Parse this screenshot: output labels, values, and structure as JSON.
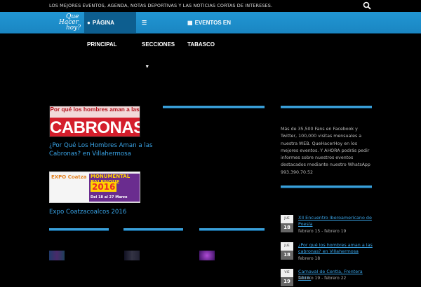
{
  "topbar": {
    "tagline": "LOS MEJORES EVENTOS, AGENDA, NOTAS DEPORTIVAS Y LAS NOTICIAS CORTAS DE INTERESES."
  },
  "logo": {
    "line1": "Que",
    "line2": "Hacer",
    "line3": "hoy?"
  },
  "nav": {
    "home": "PÁGINA PRINCIPAL",
    "sections": "SECCIONES",
    "events": "EVENTOS EN TABASCO"
  },
  "posts": [
    {
      "banner_line1": "Por qué los hombres aman a las",
      "banner_line2": "CABRONAS",
      "title": "¿Por Qué Los Hombres Aman a las Cabronas? en Villahermosa"
    },
    {
      "banner_left": "EXPO Coatza",
      "banner_title": "MONUMENTAL PALENQUE",
      "banner_year": "2016",
      "banner_date": "Del 18 al 27 Marzo",
      "title": "Expo Coatzacoalcos 2016"
    }
  ],
  "sidebar": {
    "about": "Más de 35,500 Fans en Facebook y Twitter, 100,000 visitas mensuales a nuestra WEB. QueHacerHoy en los mejores eventos. Y AHORA podrás pedir informes sobre nuestros eventos destacados mediante nuestro WhatsApp 993.390.70.52",
    "events": [
      {
        "month": "JUE",
        "day": "18",
        "title": "XII Encuentro Iberoamericano de Poesía",
        "date": "febrero 15 - febrero 19"
      },
      {
        "month": "JUE",
        "day": "18",
        "title": "¿Por qué los hombres aman a las cabronas? en Villahermosa",
        "date": "febrero 18"
      },
      {
        "month": "VIE",
        "day": "19",
        "title": "Carnaval de Centla, Frontera 2016.",
        "date": "febrero 19 - febrero 22"
      }
    ]
  },
  "colors": {
    "nav_bg": "#2196d3",
    "accent": "#3a9fd8",
    "link": "#3aa5e8"
  }
}
